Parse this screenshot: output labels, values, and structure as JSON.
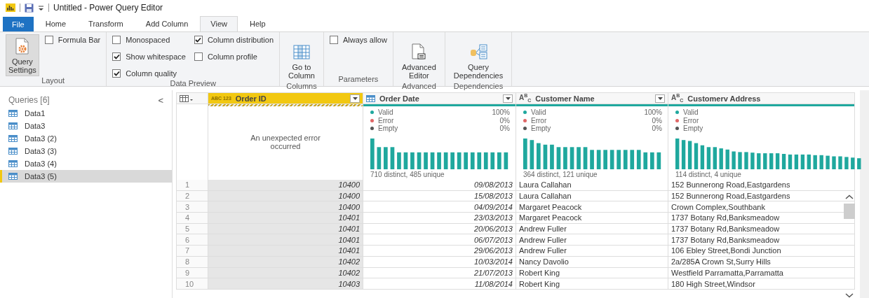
{
  "window": {
    "title": "Untitled - Power Query Editor"
  },
  "ribbon_tabs": [
    {
      "label": "File",
      "kind": "file",
      "selected": false
    },
    {
      "label": "Home",
      "kind": "tab",
      "selected": false
    },
    {
      "label": "Transform",
      "kind": "tab",
      "selected": false
    },
    {
      "label": "Add Column",
      "kind": "tab",
      "selected": false
    },
    {
      "label": "View",
      "kind": "tab",
      "selected": true
    },
    {
      "label": "Help",
      "kind": "tab",
      "selected": false
    }
  ],
  "ribbon_groups": [
    {
      "label": "Layout",
      "kind": "row",
      "controls": [
        {
          "kind": "big",
          "label": "Query Settings",
          "on": true
        },
        {
          "kind": "checkbox",
          "label": "Formula Bar",
          "checked": false
        }
      ]
    },
    {
      "label": "Data Preview",
      "kind": "grid",
      "controls": [
        {
          "kind": "checkbox",
          "label": "Monospaced",
          "checked": false
        },
        {
          "kind": "checkbox",
          "label": "Show whitespace",
          "checked": true
        },
        {
          "kind": "checkbox",
          "label": "Column quality",
          "checked": true
        },
        {
          "kind": "checkbox",
          "label": "Column distribution",
          "checked": true
        },
        {
          "kind": "checkbox",
          "label": "Column profile",
          "checked": false
        }
      ]
    },
    {
      "label": "Columns",
      "kind": "row",
      "controls": [
        {
          "kind": "big",
          "label": "Go to Column",
          "on": false
        }
      ]
    },
    {
      "label": "Parameters",
      "kind": "row",
      "controls": [
        {
          "kind": "checkbox",
          "label": "Always allow",
          "checked": false
        }
      ]
    },
    {
      "label": "Advanced",
      "kind": "row",
      "controls": [
        {
          "kind": "big",
          "label": "Advanced Editor",
          "on": false
        }
      ]
    },
    {
      "label": "Dependencies",
      "kind": "row",
      "controls": [
        {
          "kind": "big",
          "label": "Query Dependencies",
          "on": false
        }
      ]
    }
  ],
  "queries": {
    "title": "Queries [6]",
    "collapse": "<",
    "items": [
      {
        "label": "Data1",
        "selected": false
      },
      {
        "label": "Data3",
        "selected": false
      },
      {
        "label": "Data3 (2)",
        "selected": false
      },
      {
        "label": "Data3 (3)",
        "selected": false
      },
      {
        "label": "Data3 (4)",
        "selected": false
      },
      {
        "label": "Data3 (5)",
        "selected": true
      }
    ]
  },
  "grid": {
    "columns": [
      {
        "name": "Order ID",
        "kind": "any",
        "type_label": "ABC 123",
        "selected": true,
        "error": true,
        "filter_button": true,
        "message": "An unexpected error occurred"
      },
      {
        "name": "Order Date",
        "kind": "date",
        "selected": false,
        "error": false,
        "filter_button": true,
        "quality": [
          {
            "label": "Valid",
            "value": "100%",
            "color": "#1fa89e"
          },
          {
            "label": "Error",
            "value": "0%",
            "color": "#e06666"
          },
          {
            "label": "Empty",
            "value": "0%",
            "color": "#555555"
          }
        ],
        "summary": "710 distinct, 485 unique"
      },
      {
        "name": "Customer Name",
        "kind": "text",
        "type_label": "A$^{B}$$_{C}$",
        "selected": false,
        "error": false,
        "filter_button": true,
        "quality": [
          {
            "label": "Valid",
            "value": "100%",
            "color": "#1fa89e"
          },
          {
            "label": "Error",
            "value": "0%",
            "color": "#e06666"
          },
          {
            "label": "Empty",
            "value": "0%",
            "color": "#555555"
          }
        ],
        "summary": "364 distinct, 121 unique"
      },
      {
        "name": "Customerv Address",
        "kind": "text",
        "type_label": "A$^{B}$$_{C}$",
        "selected": false,
        "error": false,
        "filter_button": false,
        "quality": [
          {
            "label": "Valid",
            "color": "#1fa89e"
          },
          {
            "label": "Error",
            "color": "#e06666"
          },
          {
            "label": "Empty",
            "color": "#555555"
          }
        ],
        "summary": "114 distinct, 4 unique"
      }
    ],
    "rows": [
      {
        "number": "1",
        "cells": [
          "10400",
          "09/08/2013",
          "Laura Callahan",
          "152 Bunnerong Road,Eastgardens"
        ]
      },
      {
        "number": "2",
        "cells": [
          "10400",
          "15/08/2013",
          "Laura Callahan",
          "152 Bunnerong Road,Eastgardens"
        ]
      },
      {
        "number": "3",
        "cells": [
          "10400",
          "04/09/2014",
          "Margaret Peacock",
          "Crown Complex,Southbank"
        ]
      },
      {
        "number": "4",
        "cells": [
          "10401",
          "23/03/2013",
          "Margaret Peacock",
          "1737 Botany Rd,Banksmeadow"
        ]
      },
      {
        "number": "5",
        "cells": [
          "10401",
          "20/06/2013",
          "Andrew Fuller",
          "1737 Botany Rd,Banksmeadow"
        ]
      },
      {
        "number": "6",
        "cells": [
          "10401",
          "06/07/2013",
          "Andrew Fuller",
          "1737 Botany Rd,Banksmeadow"
        ]
      },
      {
        "number": "7",
        "cells": [
          "10401",
          "29/06/2013",
          "Andrew Fuller",
          "106 Ebley Street,Bondi Junction"
        ]
      },
      {
        "number": "8",
        "cells": [
          "10402",
          "10/03/2014",
          "Nancy Davolio",
          "2a/285A Crown St,Surry Hills"
        ]
      },
      {
        "number": "9",
        "cells": [
          "10402",
          "21/07/2013",
          "Robert King",
          "Westfield Parramatta,Parramatta"
        ]
      },
      {
        "number": "10",
        "cells": [
          "10403",
          "11/08/2014",
          "Robert King",
          "180 High Street,Windsor"
        ]
      }
    ]
  }
}
